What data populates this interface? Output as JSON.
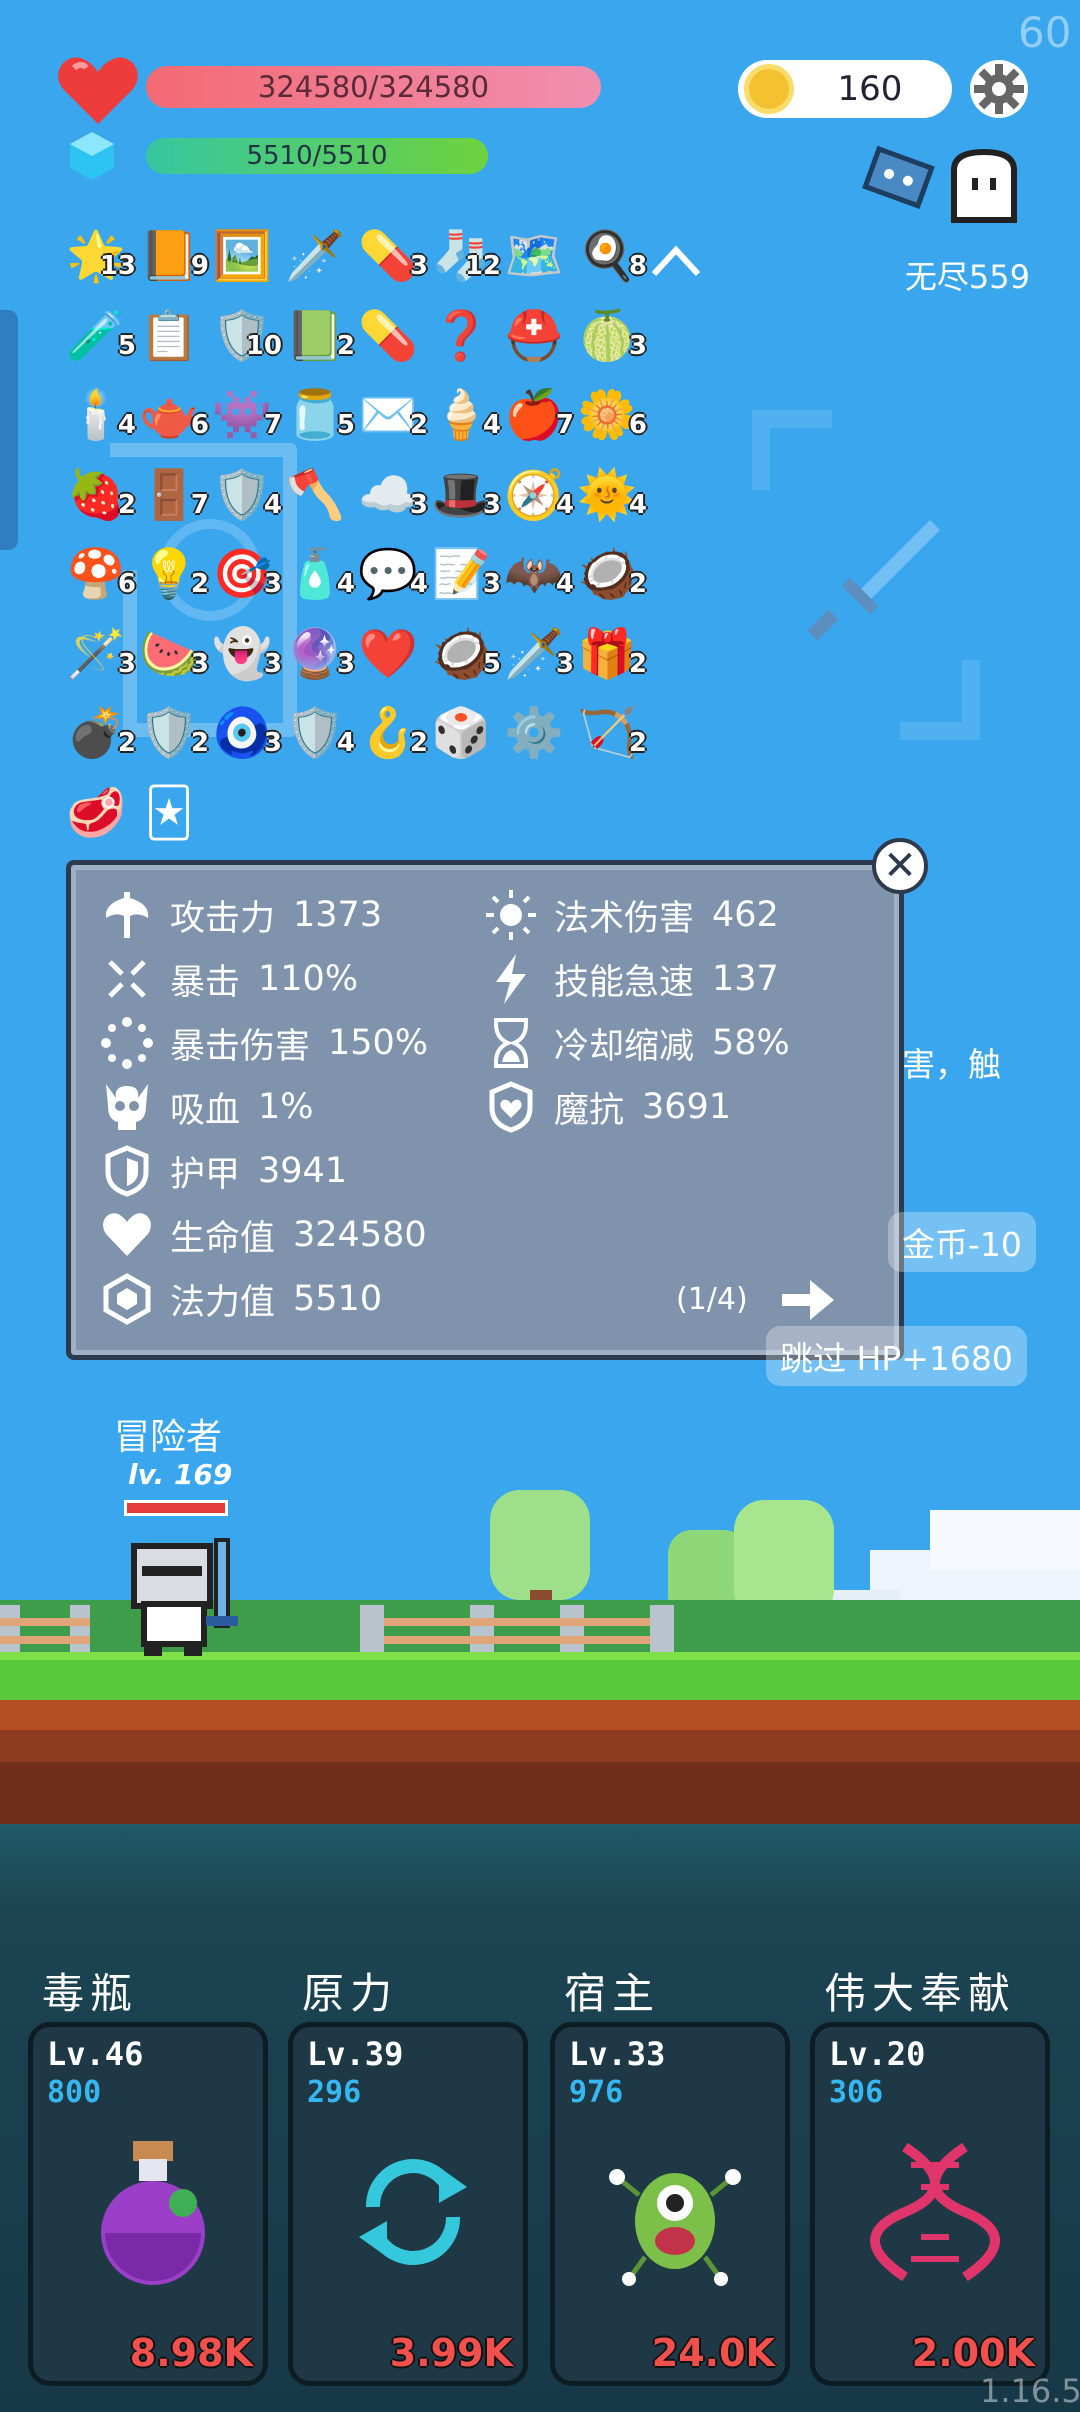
{
  "fps": "60",
  "player": {
    "hp": "324580/324580",
    "mp": "5510/5510"
  },
  "coins": "160",
  "mode": "无尽559",
  "items": [
    {
      "icon": "🌟",
      "c": "13"
    },
    {
      "icon": "📙",
      "c": "9"
    },
    {
      "icon": "🖼️",
      "c": ""
    },
    {
      "icon": "🗡️",
      "c": ""
    },
    {
      "icon": "💊",
      "c": "3"
    },
    {
      "icon": "🧦",
      "c": "12"
    },
    {
      "icon": "🗺️",
      "c": ""
    },
    {
      "icon": "🍳",
      "c": "8"
    },
    {
      "icon": "🧪",
      "c": "5"
    },
    {
      "icon": "📋",
      "c": ""
    },
    {
      "icon": "🛡️",
      "c": "10"
    },
    {
      "icon": "📗",
      "c": "2"
    },
    {
      "icon": "💊",
      "c": ""
    },
    {
      "icon": "❓",
      "c": ""
    },
    {
      "icon": "⛑️",
      "c": ""
    },
    {
      "icon": "🍈",
      "c": "3"
    },
    {
      "icon": "🕯️",
      "c": "4"
    },
    {
      "icon": "🫖",
      "c": "6"
    },
    {
      "icon": "👾",
      "c": "7"
    },
    {
      "icon": "🫙",
      "c": "5"
    },
    {
      "icon": "✉️",
      "c": "2"
    },
    {
      "icon": "🍦",
      "c": "4"
    },
    {
      "icon": "🍎",
      "c": "7"
    },
    {
      "icon": "🌼",
      "c": "6"
    },
    {
      "icon": "🍓",
      "c": "2"
    },
    {
      "icon": "🚪",
      "c": "7"
    },
    {
      "icon": "🛡️",
      "c": "4"
    },
    {
      "icon": "🪓",
      "c": ""
    },
    {
      "icon": "☁️",
      "c": "3"
    },
    {
      "icon": "🎩",
      "c": "3"
    },
    {
      "icon": "🧭",
      "c": "4"
    },
    {
      "icon": "🌞",
      "c": "4"
    },
    {
      "icon": "🍄",
      "c": "6"
    },
    {
      "icon": "💡",
      "c": "2"
    },
    {
      "icon": "🎯",
      "c": "3"
    },
    {
      "icon": "🧴",
      "c": "4"
    },
    {
      "icon": "💬",
      "c": "4"
    },
    {
      "icon": "📝",
      "c": "3"
    },
    {
      "icon": "🦇",
      "c": "4"
    },
    {
      "icon": "🥥",
      "c": "2"
    },
    {
      "icon": "🪄",
      "c": "3"
    },
    {
      "icon": "🍉",
      "c": "3"
    },
    {
      "icon": "👻",
      "c": "3"
    },
    {
      "icon": "🔮",
      "c": "3"
    },
    {
      "icon": "❤️",
      "c": ""
    },
    {
      "icon": "🥥",
      "c": "5"
    },
    {
      "icon": "🗡️",
      "c": "3"
    },
    {
      "icon": "🎁",
      "c": "2"
    },
    {
      "icon": "💣",
      "c": "2"
    },
    {
      "icon": "🛡️",
      "c": "2"
    },
    {
      "icon": "🧿",
      "c": "3"
    },
    {
      "icon": "🛡️",
      "c": "4"
    },
    {
      "icon": "🪝",
      "c": "2"
    },
    {
      "icon": "🎲",
      "c": ""
    },
    {
      "icon": "⚙️",
      "c": ""
    },
    {
      "icon": "🏹",
      "c": "2"
    },
    {
      "icon": "🥩",
      "c": ""
    },
    {
      "icon": "🃏",
      "c": ""
    }
  ],
  "stats_left": [
    {
      "icon": "axe-icon",
      "label": "攻击力",
      "value": "1373"
    },
    {
      "icon": "crit-icon",
      "label": "暴击",
      "value": "110%"
    },
    {
      "icon": "crit-damage-icon",
      "label": "暴击伤害",
      "value": "150%"
    },
    {
      "icon": "skull-icon",
      "label": "吸血",
      "value": "1%"
    },
    {
      "icon": "shield-icon",
      "label": "护甲",
      "value": "3941"
    },
    {
      "icon": "heart-icon",
      "label": "生命值",
      "value": "324580"
    },
    {
      "icon": "hexagon-icon",
      "label": "法力值",
      "value": "5510"
    }
  ],
  "stats_right": [
    {
      "icon": "sun-icon",
      "label": "法术伤害",
      "value": "462"
    },
    {
      "icon": "lightning-icon",
      "label": "技能急速",
      "value": "137"
    },
    {
      "icon": "hourglass-icon",
      "label": "冷却缩减",
      "value": "58%"
    },
    {
      "icon": "magic-shield-icon",
      "label": "魔抗",
      "value": "3691"
    }
  ],
  "page": "(1/4)",
  "bubbles": {
    "b1": "害，触",
    "b2": "金币-10",
    "b3": "跳过 HP+1680"
  },
  "hero": {
    "name": "冒险者",
    "level": "lv. 169"
  },
  "skills": [
    {
      "name": "毒瓶",
      "lv": "Lv.46",
      "num": "800",
      "val": "8.98K"
    },
    {
      "name": "原力",
      "lv": "Lv.39",
      "num": "296",
      "val": "3.99K"
    },
    {
      "name": "宿主",
      "lv": "Lv.33",
      "num": "976",
      "val": "24.0K"
    },
    {
      "name": "伟大奉献",
      "lv": "Lv.20",
      "num": "306",
      "val": "2.00K"
    }
  ],
  "version": "1.16.5"
}
